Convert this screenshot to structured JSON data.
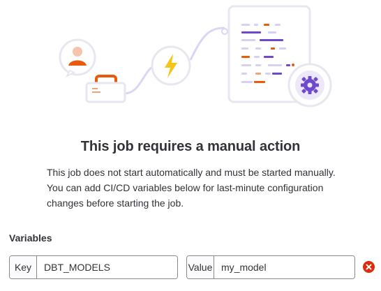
{
  "empty_state": {
    "title": "This job requires a manual action",
    "description": "This job does not start automatically and must be started manually. You can add CI/CD variables below for last-minute configuration changes before starting the job."
  },
  "variables": {
    "label": "Variables",
    "rows": [
      {
        "key_prefix": "Key",
        "key_value": "DBT_MODELS",
        "value_prefix": "Value",
        "value_value": "my_model"
      }
    ]
  },
  "icons": {
    "user": "user-avatar-icon",
    "briefcase": "briefcase-icon",
    "lightning": "lightning-bolt-icon",
    "settings": "gear-icon",
    "remove": "remove-circle-icon"
  },
  "colors": {
    "brand_orange": "#e9590e",
    "brand_purple": "#6e49cb",
    "light_purple": "#d6d1f3",
    "lightning_yellow": "#f5c518",
    "danger_red": "#dd2b0e"
  }
}
